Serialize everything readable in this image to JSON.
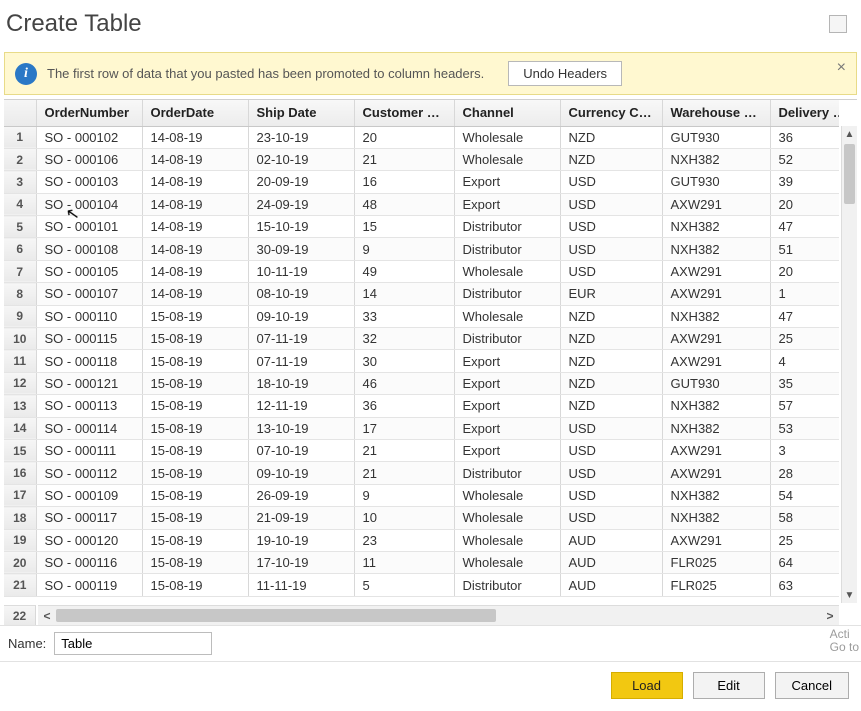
{
  "window": {
    "title": "Create Table"
  },
  "banner": {
    "message": "The first row of data that you pasted has been promoted to column headers.",
    "undo_label": "Undo Headers"
  },
  "grid": {
    "headers": [
      "OrderNumber",
      "OrderDate",
      "Ship Date",
      "Customer Na...",
      "Channel",
      "Currency Code",
      "Warehouse C...",
      "Delivery Regi..."
    ],
    "rows": [
      [
        "SO - 000102",
        "14-08-19",
        "23-10-19",
        "20",
        "Wholesale",
        "NZD",
        "GUT930",
        "36"
      ],
      [
        "SO - 000106",
        "14-08-19",
        "02-10-19",
        "21",
        "Wholesale",
        "NZD",
        "NXH382",
        "52"
      ],
      [
        "SO - 000103",
        "14-08-19",
        "20-09-19",
        "16",
        "Export",
        "USD",
        "GUT930",
        "39"
      ],
      [
        "SO - 000104",
        "14-08-19",
        "24-09-19",
        "48",
        "Export",
        "USD",
        "AXW291",
        "20"
      ],
      [
        "SO - 000101",
        "14-08-19",
        "15-10-19",
        "15",
        "Distributor",
        "USD",
        "NXH382",
        "47"
      ],
      [
        "SO - 000108",
        "14-08-19",
        "30-09-19",
        "9",
        "Distributor",
        "USD",
        "NXH382",
        "51"
      ],
      [
        "SO - 000105",
        "14-08-19",
        "10-11-19",
        "49",
        "Wholesale",
        "USD",
        "AXW291",
        "20"
      ],
      [
        "SO - 000107",
        "14-08-19",
        "08-10-19",
        "14",
        "Distributor",
        "EUR",
        "AXW291",
        "1"
      ],
      [
        "SO - 000110",
        "15-08-19",
        "09-10-19",
        "33",
        "Wholesale",
        "NZD",
        "NXH382",
        "47"
      ],
      [
        "SO - 000115",
        "15-08-19",
        "07-11-19",
        "32",
        "Distributor",
        "NZD",
        "AXW291",
        "25"
      ],
      [
        "SO - 000118",
        "15-08-19",
        "07-11-19",
        "30",
        "Export",
        "NZD",
        "AXW291",
        "4"
      ],
      [
        "SO - 000121",
        "15-08-19",
        "18-10-19",
        "46",
        "Export",
        "NZD",
        "GUT930",
        "35"
      ],
      [
        "SO - 000113",
        "15-08-19",
        "12-11-19",
        "36",
        "Export",
        "NZD",
        "NXH382",
        "57"
      ],
      [
        "SO - 000114",
        "15-08-19",
        "13-10-19",
        "17",
        "Export",
        "USD",
        "NXH382",
        "53"
      ],
      [
        "SO - 000111",
        "15-08-19",
        "07-10-19",
        "21",
        "Export",
        "USD",
        "AXW291",
        "3"
      ],
      [
        "SO - 000112",
        "15-08-19",
        "09-10-19",
        "21",
        "Distributor",
        "USD",
        "AXW291",
        "28"
      ],
      [
        "SO - 000109",
        "15-08-19",
        "26-09-19",
        "9",
        "Wholesale",
        "USD",
        "NXH382",
        "54"
      ],
      [
        "SO - 000117",
        "15-08-19",
        "21-09-19",
        "10",
        "Wholesale",
        "USD",
        "NXH382",
        "58"
      ],
      [
        "SO - 000120",
        "15-08-19",
        "19-10-19",
        "23",
        "Wholesale",
        "AUD",
        "AXW291",
        "25"
      ],
      [
        "SO - 000116",
        "15-08-19",
        "17-10-19",
        "11",
        "Wholesale",
        "AUD",
        "FLR025",
        "64"
      ],
      [
        "SO - 000119",
        "15-08-19",
        "11-11-19",
        "5",
        "Distributor",
        "AUD",
        "FLR025",
        "63"
      ]
    ],
    "overflow_row_num": "22"
  },
  "namebar": {
    "label": "Name:",
    "value": "Table"
  },
  "footer": {
    "load": "Load",
    "edit": "Edit",
    "cancel": "Cancel"
  },
  "watermark": {
    "line1": "Acti",
    "line2": "Go to"
  }
}
